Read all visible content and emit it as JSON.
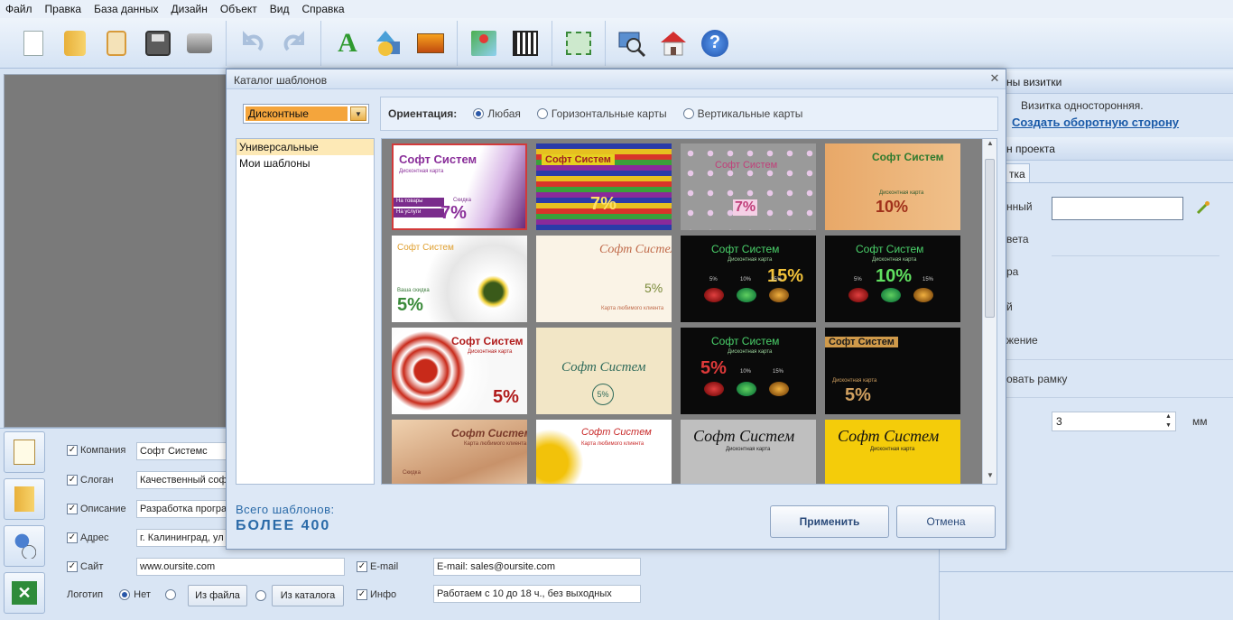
{
  "menu": [
    "Файл",
    "Правка",
    "База данных",
    "Дизайн",
    "Объект",
    "Вид",
    "Справка"
  ],
  "toolbar": {
    "groups": [
      [
        "new-document-icon",
        "open-folder-icon",
        "clipboard-icon",
        "save-icon",
        "print-icon"
      ],
      [
        "undo-icon",
        "redo-icon"
      ],
      [
        "text-icon",
        "shapes-icon",
        "image-icon"
      ],
      [
        "map-icon",
        "qr-code-icon"
      ],
      [
        "fit-to-screen-icon"
      ],
      [
        "zoom-icon",
        "home-icon",
        "help-icon"
      ]
    ]
  },
  "dialog": {
    "title": "Каталог шаблонов",
    "category": "Дисконтные",
    "orientation_label": "Ориентация:",
    "orientation_options": [
      "Любая",
      "Горизонтальные карты",
      "Вертикальные карты"
    ],
    "orientation_selected": "Любая",
    "tree": [
      "Универсальные",
      "Мои шаблоны"
    ],
    "total_label": "Всего шаблонов:",
    "total_value": "БОЛЕЕ 400",
    "apply": "Применить",
    "cancel": "Отмена",
    "cards": [
      {
        "title": "Софт Систем",
        "sub": "Дисконтная карта",
        "pct": "7%",
        "label1": "На товары",
        "label2": "На услуги",
        "label3": "Скидка"
      },
      {
        "title": "Софт Систем",
        "pct": "7%"
      },
      {
        "title": "Софт Систем",
        "pct": "7%"
      },
      {
        "title": "Софт Систем",
        "sub": "Дисконтная карта",
        "pct": "10%"
      },
      {
        "title": "Софт Систем",
        "label1": "Ваша скидка",
        "pct": "5%"
      },
      {
        "title": "Софт Систем",
        "pct": "5%",
        "label1": "Карта любимого клиента"
      },
      {
        "title": "Софт Систем",
        "sub": "Дисконтная карта",
        "pct": "15%",
        "a": "5%",
        "b": "10%",
        "c": "15%"
      },
      {
        "title": "Софт Систем",
        "sub": "Дисконтная карта",
        "pct": "10%",
        "a": "5%",
        "b": "10%",
        "c": "15%"
      },
      {
        "title": "Софт Систем",
        "sub": "Дисконтная карта",
        "pct": "5%"
      },
      {
        "title": "Софт Систем",
        "pct": "5%"
      },
      {
        "title": "Софт Систем",
        "sub": "Дисконтная карта",
        "pct": "5%",
        "a": "10%",
        "b": "15%"
      },
      {
        "title": "Софт Систем",
        "sub": "Дисконтная карта",
        "pct": "5%"
      },
      {
        "title": "Софт Систем",
        "sub": "Карта любимого клиента",
        "label1": "Скидка"
      },
      {
        "title": "Софт Систем",
        "sub": "Карта любимого клиента"
      },
      {
        "title": "Софт Систем",
        "sub": "Дисконтная карта"
      },
      {
        "title": "Софт Систем",
        "sub": "Дисконтная карта"
      }
    ]
  },
  "right_panel": {
    "head1": "ны визитки",
    "line1": "Визитка односторонняя.",
    "link": "Создать оборотную сторону",
    "head2": "н проекта",
    "tab": "тка",
    "labels": [
      "нный",
      "вета",
      "ра",
      "й",
      "жение",
      "овать рамку"
    ],
    "spin_value": "3",
    "spin_unit": "мм"
  },
  "form": {
    "fields": [
      {
        "label": "Компания",
        "value": "Софт Системс"
      },
      {
        "label": "Слоган",
        "value": "Качественный соф"
      },
      {
        "label": "Описание",
        "value": "Разработка програ"
      },
      {
        "label": "Адрес",
        "value": "г. Калининград, ул"
      },
      {
        "label": "Сайт",
        "value": "www.oursite.com"
      }
    ],
    "email_label": "E-mail",
    "email_value": "E-mail: sales@oursite.com",
    "info_label": "Инфо",
    "info_value": "Работаем с 10 до 18 ч., без выходных",
    "logo_label": "Логотип",
    "logo_none": "Нет",
    "from_file": "Из файла",
    "from_catalog": "Из каталога"
  }
}
